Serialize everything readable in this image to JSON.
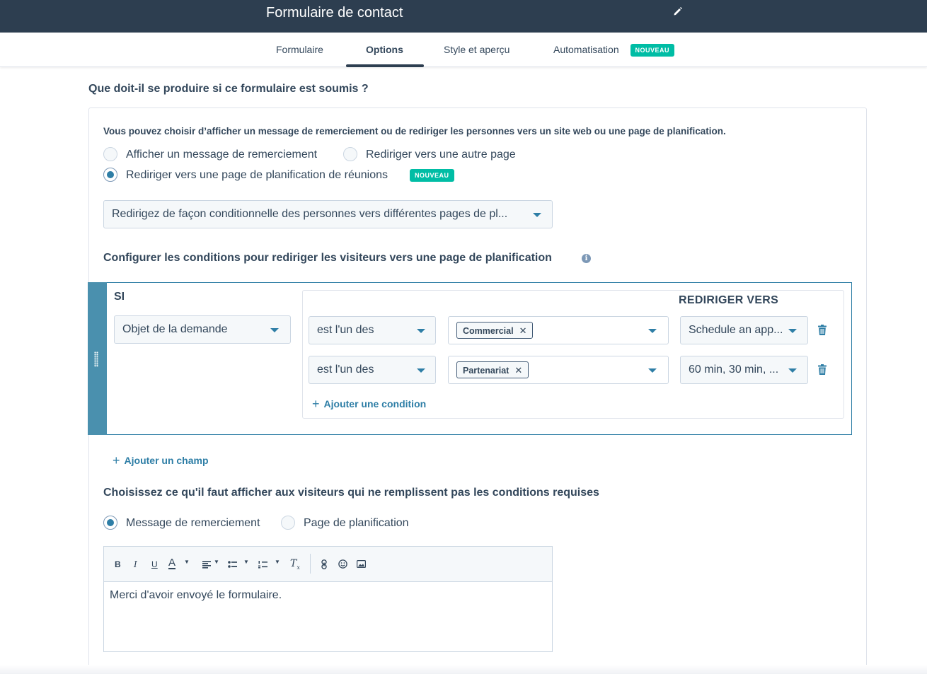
{
  "header": {
    "title": "Formulaire de contact",
    "edit_icon": "pencil-icon"
  },
  "tabs": [
    {
      "label": "Formulaire",
      "active": false
    },
    {
      "label": "Options",
      "active": true
    },
    {
      "label": "Style et aperçu",
      "active": false
    },
    {
      "label": "Automatisation",
      "active": false,
      "badge": "NOUVEAU"
    }
  ],
  "submission": {
    "question": "Que doit-il se produire si ce formulaire est soumis ?",
    "description": "Vous pouvez choisir d’afficher un message de remerciement ou de rediriger les personnes vers un site web ou une page de planification.",
    "options": [
      {
        "label": "Afficher un message de remerciement",
        "checked": false
      },
      {
        "label": "Rediriger vers une autre page",
        "checked": false
      },
      {
        "label": "Rediriger vers une page de planification de réunions",
        "checked": true,
        "badge": "NOUVEAU"
      }
    ],
    "redirect_mode": "Redirigez de façon conditionnelle des personnes vers différentes pages de pl..."
  },
  "conditions": {
    "heading": "Configurer les conditions pour rediriger les visiteurs vers une page de planification",
    "if_label": "SI",
    "redirect_label": "REDIRIGER VERS",
    "field": "Objet de la demande",
    "rows": [
      {
        "operator": "est l'un des",
        "tag": "Commercial",
        "target": "Schedule an app..."
      },
      {
        "operator": "est l'un des",
        "tag": "Partenariat",
        "target": "60 min, 30 min, ..."
      }
    ],
    "add_condition": "Ajouter une condition",
    "add_field": "Ajouter un champ"
  },
  "fallback": {
    "heading": "Choisissez ce qu'il faut afficher aux visiteurs qui ne remplissent pas les conditions requises",
    "options": [
      {
        "label": "Message de remerciement",
        "checked": true
      },
      {
        "label": "Page de planification",
        "checked": false
      }
    ],
    "editor_text": "Merci d'avoir envoyé le formulaire.",
    "toolbar": {
      "bold": "B",
      "italic": "I",
      "underline": "U",
      "color": "A",
      "clear": "T"
    }
  },
  "colors": {
    "header_bg": "#2d3e50",
    "accent": "#2e7ea6",
    "badge": "#00bda5",
    "condition_bar": "#4a90ae"
  }
}
